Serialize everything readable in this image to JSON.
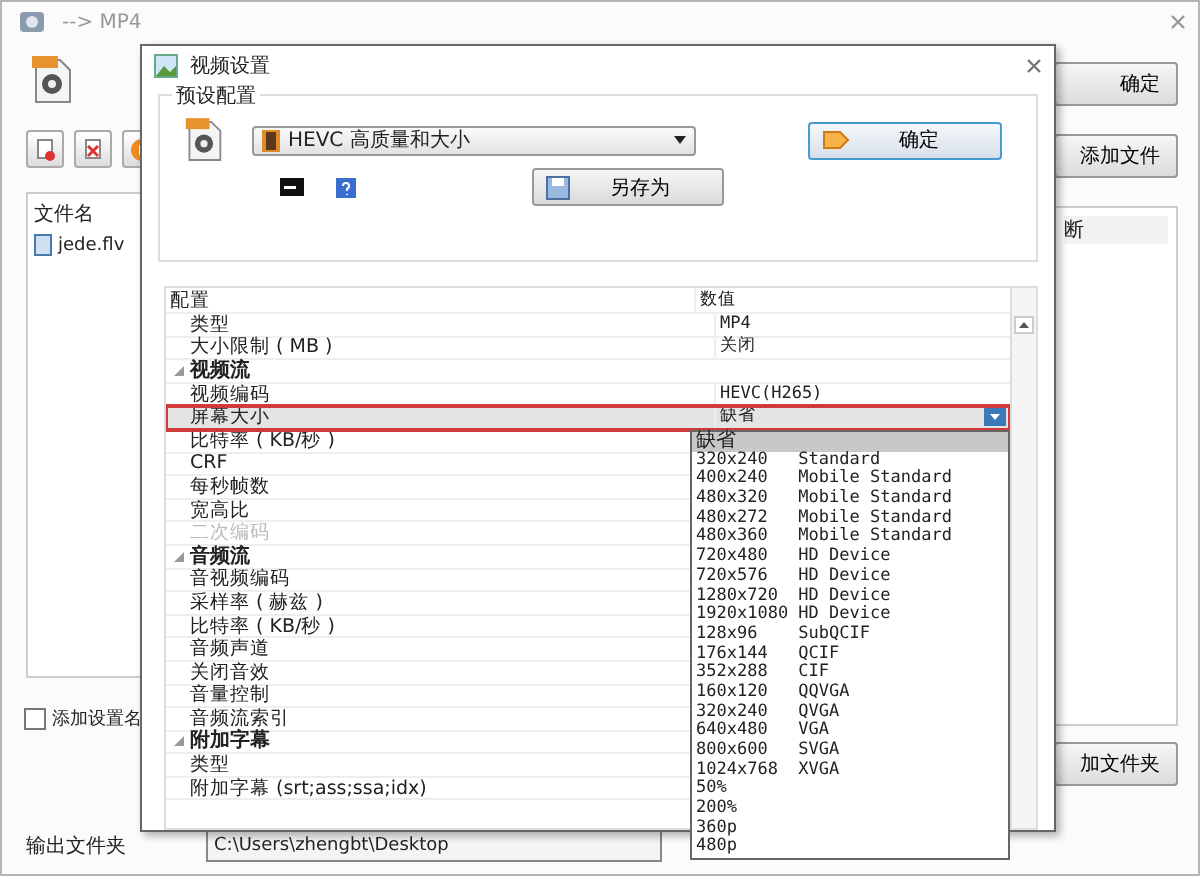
{
  "window": {
    "title": "--> MP4",
    "buttons": [
      {
        "label": "确定"
      },
      {
        "label": "添加文件"
      }
    ],
    "file_list": {
      "columns": [
        "文件名",
        "断"
      ],
      "rows": [
        "jede.flv"
      ]
    },
    "add_setting_name": {
      "label": "添加设置名",
      "checked": false
    },
    "add_folder_button": "加文件夹",
    "output_folder": {
      "label": "输出文件夹",
      "value": "C:\\Users\\zhengbt\\Desktop"
    }
  },
  "dialog": {
    "title": "视频设置",
    "preset_group": {
      "title": "预设配置",
      "preset": "HEVC 高质量和大小",
      "ok_button": "确定",
      "save_as_button": "另存为"
    },
    "grid": {
      "columns": [
        "配置",
        "数值"
      ],
      "rows": [
        {
          "kind": "item",
          "label": "类型",
          "value": "MP4",
          "disabled": false,
          "selected": false
        },
        {
          "kind": "item",
          "label": "大小限制 ( MB )",
          "value": "关闭",
          "disabled": false,
          "selected": false
        },
        {
          "kind": "group",
          "label": "视频流",
          "expanded": true,
          "selected": false
        },
        {
          "kind": "item",
          "label": "视频编码",
          "value": "HEVC(H265)",
          "disabled": false,
          "selected": false
        },
        {
          "kind": "item",
          "label": "屏幕大小",
          "value": "缺省",
          "disabled": false,
          "selected": true
        },
        {
          "kind": "item",
          "label": "比特率 ( KB/秒 )",
          "disabled": false,
          "selected": false
        },
        {
          "kind": "item",
          "label": "CRF",
          "disabled": false,
          "selected": false
        },
        {
          "kind": "item",
          "label": "每秒帧数",
          "disabled": false,
          "selected": false
        },
        {
          "kind": "item",
          "label": "宽高比",
          "disabled": false,
          "selected": false
        },
        {
          "kind": "item",
          "label": "二次编码",
          "disabled": true,
          "selected": false
        },
        {
          "kind": "group",
          "label": "音频流",
          "expanded": true,
          "selected": false
        },
        {
          "kind": "item",
          "label": "音视频编码",
          "disabled": false,
          "selected": false
        },
        {
          "kind": "item",
          "label": "采样率 ( 赫兹 )",
          "disabled": false,
          "selected": false
        },
        {
          "kind": "item",
          "label": "比特率 ( KB/秒 )",
          "disabled": false,
          "selected": false
        },
        {
          "kind": "item",
          "label": "音频声道",
          "disabled": false,
          "selected": false
        },
        {
          "kind": "item",
          "label": "关闭音效",
          "disabled": false,
          "selected": false
        },
        {
          "kind": "item",
          "label": "音量控制",
          "disabled": false,
          "selected": false
        },
        {
          "kind": "item",
          "label": "音频流索引",
          "disabled": false,
          "selected": false
        },
        {
          "kind": "group",
          "label": "附加字幕",
          "expanded": true,
          "selected": false
        },
        {
          "kind": "item",
          "label": "类型",
          "disabled": false,
          "selected": false
        },
        {
          "kind": "item",
          "label": "附加字幕 (srt;ass;ssa;idx)",
          "disabled": false,
          "selected": false
        }
      ]
    },
    "dropdown": {
      "options": [
        {
          "label": "缺省",
          "selected": true
        },
        {
          "label": "320x240   Standard",
          "selected": false
        },
        {
          "label": "400x240   Mobile Standard",
          "selected": false
        },
        {
          "label": "480x320   Mobile Standard",
          "selected": false
        },
        {
          "label": "480x272   Mobile Standard",
          "selected": false
        },
        {
          "label": "480x360   Mobile Standard",
          "selected": false
        },
        {
          "label": "720x480   HD Device",
          "selected": false
        },
        {
          "label": "720x576   HD Device",
          "selected": false
        },
        {
          "label": "1280x720  HD Device",
          "selected": false
        },
        {
          "label": "1920x1080 HD Device",
          "selected": false
        },
        {
          "label": "128x96    SubQCIF",
          "selected": false
        },
        {
          "label": "176x144   QCIF",
          "selected": false
        },
        {
          "label": "352x288   CIF",
          "selected": false
        },
        {
          "label": "160x120   QQVGA",
          "selected": false
        },
        {
          "label": "320x240   QVGA",
          "selected": false
        },
        {
          "label": "640x480   VGA",
          "selected": false
        },
        {
          "label": "800x600   SVGA",
          "selected": false
        },
        {
          "label": "1024x768  XVGA",
          "selected": false
        },
        {
          "label": "50%",
          "selected": false
        },
        {
          "label": "200%",
          "selected": false
        },
        {
          "label": "360p",
          "selected": false
        },
        {
          "label": "480p",
          "selected": false
        }
      ]
    }
  }
}
